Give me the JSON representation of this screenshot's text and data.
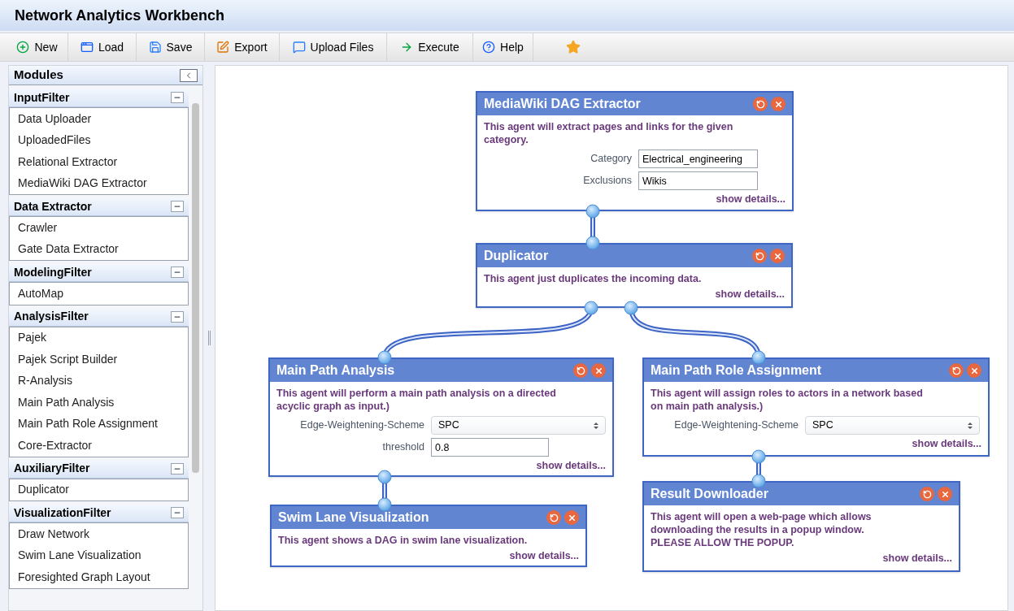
{
  "window": {
    "title": "Network Analytics Workbench"
  },
  "toolbar": [
    {
      "label": "New"
    },
    {
      "label": "Load"
    },
    {
      "label": "Save"
    },
    {
      "label": "Export"
    },
    {
      "label": "Upload Files"
    },
    {
      "label": "Execute"
    },
    {
      "label": "Help"
    }
  ],
  "sidebar": {
    "title": "Modules",
    "groups": [
      {
        "title": "InputFilter",
        "expanded": true,
        "items": [
          "Data Uploader",
          "UploadedFiles",
          "Relational Extractor",
          "MediaWiki DAG Extractor"
        ]
      },
      {
        "title": "Data Extractor",
        "expanded": true,
        "items": [
          "Crawler",
          "Gate Data Extractor"
        ]
      },
      {
        "title": "ModelingFilter",
        "expanded": true,
        "items": [
          "AutoMap"
        ]
      },
      {
        "title": "AnalysisFilter",
        "expanded": true,
        "items": [
          "Pajek",
          "Pajek Script Builder",
          "R-Analysis",
          "Main Path Analysis",
          "Main Path Role Assignment",
          "Core-Extractor"
        ]
      },
      {
        "title": "AuxiliaryFilter",
        "expanded": true,
        "items": [
          "Duplicator"
        ]
      },
      {
        "title": "VisualizationFilter",
        "expanded": true,
        "items": [
          "Draw Network",
          "Swim Lane Visualization",
          "Foresighted Graph Layout"
        ]
      }
    ]
  },
  "canvas": {
    "nodes": [
      {
        "title": "MediaWiki DAG Extractor",
        "description": "This agent will extract pages and links for the given category.",
        "fields": [
          {
            "kind": "text",
            "label": "Category",
            "value": "Electrical_engineering"
          },
          {
            "kind": "text",
            "label": "Exclusions",
            "value": "Wikis"
          }
        ],
        "link": "show details..."
      },
      {
        "title": "Duplicator",
        "description": "This agent just duplicates the incoming data.",
        "link": "show details..."
      },
      {
        "title": "Main Path Analysis",
        "description": "This agent will perform a main path analysis on a directed acyclic graph as input.)",
        "fields": [
          {
            "kind": "select",
            "label": "Edge-Weightening-Scheme",
            "value": "SPC"
          },
          {
            "kind": "text",
            "label": "threshold",
            "value": "0.8"
          }
        ],
        "link": "show details..."
      },
      {
        "title": "Main Path Role Assignment",
        "description": "This agent will assign roles to actors in a network based on main path analysis.)",
        "fields": [
          {
            "kind": "select",
            "label": "Edge-Weightening-Scheme",
            "value": "SPC"
          }
        ],
        "link": "show details..."
      },
      {
        "title": "Swim Lane Visualization",
        "description": "This agent shows a DAG in swim lane visualization.",
        "link": "show details..."
      },
      {
        "title": "Result Downloader",
        "description": "This agent will open a web-page which allows downloading the results in a popup window. PLEASE ALLOW THE POPUP.",
        "link": "show details..."
      }
    ]
  }
}
